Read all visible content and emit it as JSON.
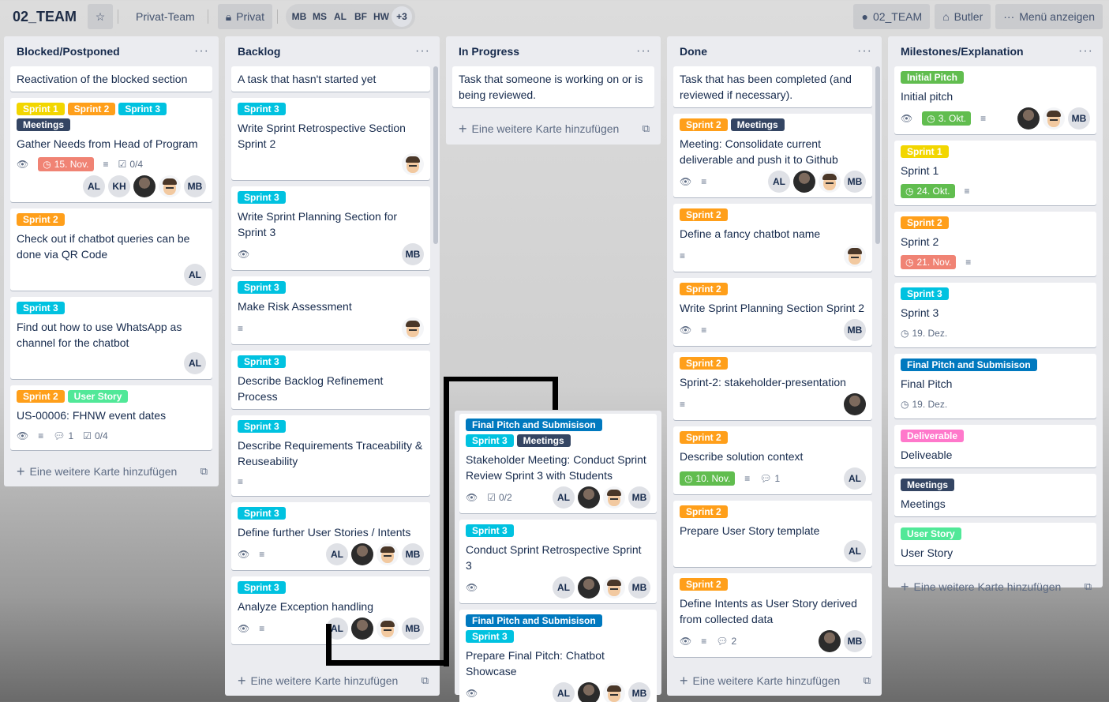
{
  "header": {
    "board_name": "02_TEAM",
    "team_label": "Privat-Team",
    "visibility_label": "Privat",
    "members": [
      "MB",
      "MS",
      "AL",
      "BF",
      "HW"
    ],
    "members_more": "+3",
    "github_label": "02_TEAM",
    "butler_label": "Butler",
    "menu_label": "Menü anzeigen"
  },
  "add_card_label": "Eine weitere Karte hinzufügen",
  "colors": {
    "yellow": "#f2d600",
    "orange": "#ff9f1a",
    "sky": "#00c2e0",
    "dark": "#344563",
    "green": "#61bd4f",
    "lime": "#51e898",
    "blue": "#0079bf",
    "pink": "#ff78cb"
  },
  "lists": [
    {
      "title": "Blocked/Postponed",
      "cards": [
        {
          "title": "Reactivation of the blocked section"
        },
        {
          "labels": [
            "Sprint 1",
            "Sprint 2",
            "Sprint 3",
            "Meetings"
          ],
          "title": "Gather Needs from Head of Program",
          "watch": true,
          "due": "15. Nov.",
          "desc": true,
          "checklist": "0/4",
          "members": [
            "AL",
            "KH",
            "photo",
            "emoji",
            "MB"
          ]
        },
        {
          "labels": [
            "Sprint 2"
          ],
          "title": "Check out if chatbot queries can be done via QR Code",
          "members": [
            "AL"
          ]
        },
        {
          "labels": [
            "Sprint 3"
          ],
          "title": "Find out how to use WhatsApp as channel for the chatbot",
          "members": [
            "AL"
          ]
        },
        {
          "labels": [
            "Sprint 2",
            "User Story"
          ],
          "title": "US-00006: FHNW event dates",
          "watch": true,
          "desc": true,
          "comments": "1",
          "checklist": "0/4"
        }
      ]
    },
    {
      "title": "Backlog",
      "cards": [
        {
          "title": "A task that hasn't started yet"
        },
        {
          "labels": [
            "Sprint 3"
          ],
          "title": "Write Sprint Retrospective Section Sprint 2",
          "members": [
            "emoji"
          ]
        },
        {
          "labels": [
            "Sprint 3"
          ],
          "title": "Write Sprint Planning Section for Sprint 3",
          "watch": true,
          "members": [
            "MB"
          ]
        },
        {
          "labels": [
            "Sprint 3"
          ],
          "title": "Make Risk Assessment",
          "desc": true,
          "members": [
            "emoji"
          ]
        },
        {
          "labels": [
            "Sprint 3"
          ],
          "title": "Describe Backlog Refinement Process"
        },
        {
          "labels": [
            "Sprint 3"
          ],
          "title": "Describe Requirements Traceability & Reuseability",
          "desc": true
        },
        {
          "labels": [
            "Sprint 3"
          ],
          "title": "Define further User Stories / Intents",
          "watch": true,
          "desc": true,
          "members": [
            "AL",
            "photo",
            "emoji",
            "MB"
          ]
        },
        {
          "labels": [
            "Sprint 3"
          ],
          "title": "Analyze Exception handling",
          "watch": true,
          "desc": true,
          "members": [
            "AL",
            "photo",
            "emoji",
            "MB"
          ]
        }
      ]
    },
    {
      "title": "In Progress",
      "cards": [
        {
          "title": "Task that someone is working on or is being reviewed."
        }
      ]
    },
    {
      "title": "Done",
      "cards": [
        {
          "title": "Task that has been completed (and reviewed if necessary)."
        },
        {
          "labels": [
            "Sprint 2",
            "Meetings"
          ],
          "title": "Meeting: Consolidate current deliverable and push it to Github",
          "watch": true,
          "desc": true,
          "members": [
            "AL",
            "photo",
            "emoji",
            "MB"
          ]
        },
        {
          "labels": [
            "Sprint 2"
          ],
          "title": "Define a fancy chatbot name",
          "desc": true,
          "members": [
            "emoji"
          ]
        },
        {
          "labels": [
            "Sprint 2"
          ],
          "title": "Write Sprint Planning Section Sprint 2",
          "watch": true,
          "desc": true,
          "members": [
            "MB"
          ]
        },
        {
          "labels": [
            "Sprint 2"
          ],
          "title": "Sprint-2: stakeholder-presentation",
          "desc": true,
          "members": [
            "photo"
          ]
        },
        {
          "labels": [
            "Sprint 2"
          ],
          "title": "Describe solution context",
          "due_green": "10. Nov.",
          "desc": true,
          "comments": "1",
          "members": [
            "AL"
          ]
        },
        {
          "labels": [
            "Sprint 2"
          ],
          "title": "Prepare User Story template",
          "members": [
            "AL"
          ]
        },
        {
          "labels": [
            "Sprint 2"
          ],
          "title": "Define Intents as User Story derived from collected data",
          "watch": true,
          "desc": true,
          "comments": "2",
          "members": [
            "photo",
            "MB"
          ]
        }
      ]
    },
    {
      "title": "Milestones/Explanation",
      "cards": [
        {
          "labels": [
            "Initial Pitch"
          ],
          "title": "Initial pitch",
          "watch": true,
          "due_green": "3. Okt.",
          "desc": true,
          "members": [
            "photo",
            "emoji",
            "MB"
          ]
        },
        {
          "labels": [
            "Sprint 1"
          ],
          "title": "Sprint 1",
          "due_green": "24. Okt.",
          "desc": true
        },
        {
          "labels": [
            "Sprint 2"
          ],
          "title": "Sprint 2",
          "due": "21. Nov.",
          "desc": true
        },
        {
          "labels": [
            "Sprint 3"
          ],
          "title": "Sprint 3",
          "due_plain": "19. Dez."
        },
        {
          "labels": [
            "Final Pitch and Submisison"
          ],
          "title": "Final Pitch",
          "due_plain": "19. Dez."
        },
        {
          "labels": [
            "Deliverable"
          ],
          "title": "Deliveable"
        },
        {
          "labels": [
            "Meetings"
          ],
          "title": "Meetings"
        },
        {
          "labels": [
            "User Story"
          ],
          "title": "User Story"
        }
      ]
    }
  ],
  "dragged_list": {
    "cards": [
      {
        "labels": [
          "Final Pitch and Submisison",
          "Sprint 3",
          "Meetings"
        ],
        "title": "Stakeholder Meeting: Conduct Sprint Review Sprint 3 with Students",
        "watch": true,
        "checklist": "0/2",
        "members": [
          "AL",
          "photo",
          "emoji",
          "MB"
        ]
      },
      {
        "labels": [
          "Sprint 3"
        ],
        "title": "Conduct Sprint Retrospective Sprint 3",
        "watch": true,
        "members": [
          "AL",
          "photo",
          "emoji",
          "MB"
        ]
      },
      {
        "labels": [
          "Final Pitch and Submisison",
          "Sprint 3"
        ],
        "title": "Prepare Final Pitch: Chatbot Showcase",
        "watch": true,
        "members": [
          "AL",
          "photo",
          "emoji",
          "MB"
        ]
      }
    ]
  }
}
